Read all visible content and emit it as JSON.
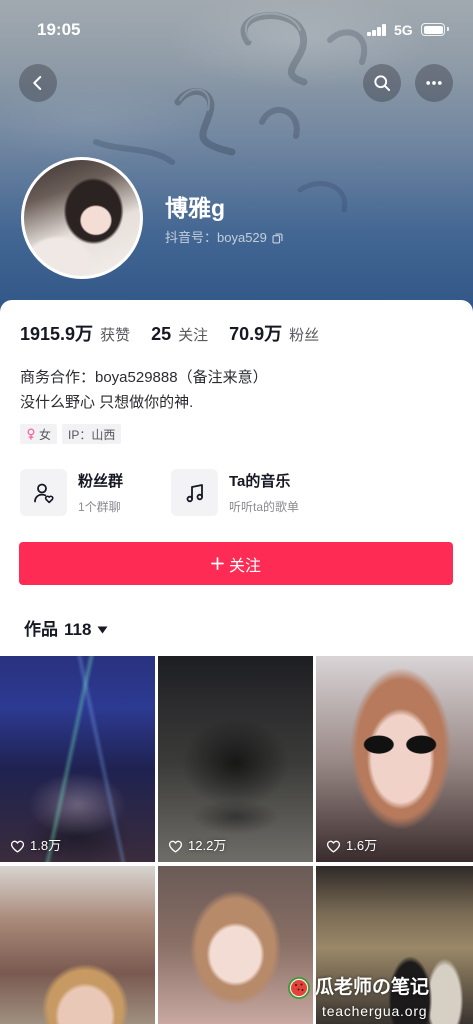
{
  "status_bar": {
    "time": "19:05",
    "network": "5G",
    "signal_icon": "signal-bars-icon",
    "battery_icon": "battery-icon"
  },
  "nav": {
    "back_icon": "chevron-left-icon",
    "search_icon": "search-icon",
    "more_icon": "more-horizontal-icon"
  },
  "profile": {
    "name": "博雅g",
    "douyin_id": "抖音号：boya529",
    "copy_icon": "copy-icon"
  },
  "stats": [
    {
      "value": "1915.9万",
      "label": "获赞"
    },
    {
      "value": "25",
      "label": "关注"
    },
    {
      "value": "70.9万",
      "label": "粉丝"
    }
  ],
  "bio": {
    "lines": [
      "商务合作：boya529888（备注来意）",
      "没什么野心 只想做你的神."
    ]
  },
  "tags": [
    {
      "icon": "female-icon",
      "text": "女"
    },
    {
      "text": "IP：山西"
    }
  ],
  "features": [
    {
      "icon": "fan-group-icon",
      "title": "粉丝群",
      "subtitle": "1个群聊"
    },
    {
      "icon": "music-note-icon",
      "title": "Ta的音乐",
      "subtitle": "听听ta的歌单"
    }
  ],
  "follow_button": {
    "icon": "plus-icon",
    "label": "关注"
  },
  "works_tab": {
    "label": "作品",
    "count": "118",
    "icon": "caret-down-icon"
  },
  "videos": [
    {
      "icon": "heart-outline-icon",
      "likes": "1.8万"
    },
    {
      "icon": "heart-outline-icon",
      "likes": "12.2万"
    },
    {
      "icon": "heart-outline-icon",
      "likes": "1.6万"
    },
    {},
    {},
    {}
  ],
  "watermark": {
    "icon": "watermelon-icon",
    "title": "瓜老师の笔记",
    "url": "teachergua.org"
  },
  "colors": {
    "accent": "#FE2C55",
    "female": "#F4679D",
    "text_primary": "#161823",
    "text_secondary": "#8A8B91"
  }
}
